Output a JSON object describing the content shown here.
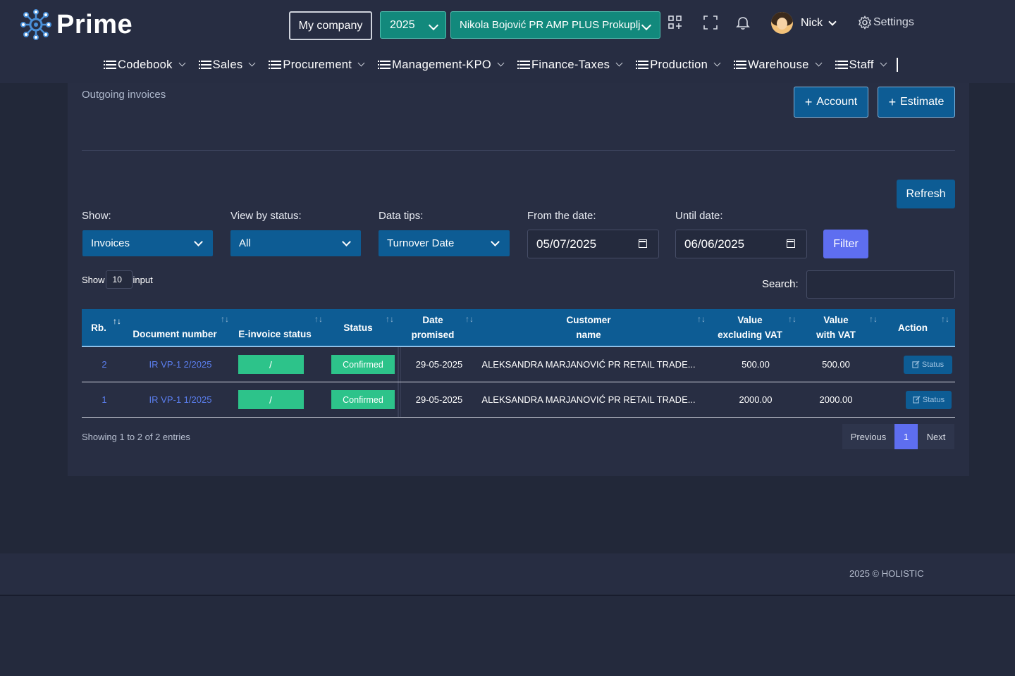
{
  "brand": {
    "name": "Prime"
  },
  "header": {
    "company_button": "My company",
    "year": "2025",
    "firm": "Nikola Bojović PR AMP PLUS Prokuplj",
    "user_name": "Nick",
    "settings_label": "Settings"
  },
  "menu": [
    {
      "label": "Codebook"
    },
    {
      "label": "Sales"
    },
    {
      "label": "Procurement"
    },
    {
      "label": "Management-KPO"
    },
    {
      "label": "Finance-Taxes"
    },
    {
      "label": "Production"
    },
    {
      "label": "Warehouse"
    },
    {
      "label": "Staff"
    }
  ],
  "page": {
    "title": "Outgoing invoices",
    "account_button": "Account",
    "estimate_button": "Estimate",
    "refresh_button": "Refresh",
    "filter_button": "Filter"
  },
  "filters": {
    "show_label": "Show:",
    "show_value": "Invoices",
    "status_label": "View by status:",
    "status_value": "All",
    "tips_label": "Data tips:",
    "tips_value": "Turnover Date",
    "from_label": "From the date:",
    "from_value": "05/07/2025",
    "until_label": "Until date:",
    "until_value": "06/06/2025"
  },
  "table_controls": {
    "show_prefix": "Show",
    "page_size": "10",
    "show_suffix": "input",
    "search_label": "Search:"
  },
  "table": {
    "headers": {
      "rb": "Rb.",
      "doc": "Document number",
      "einv": "E-invoice status",
      "status": "Status",
      "date_1": "Date",
      "date_2": "promised",
      "cust_1": "Customer",
      "cust_2": "name",
      "vex_1": "Value",
      "vex_2": "excluding VAT",
      "vin_1": "Value",
      "vin_2": "with VAT",
      "action": "Action"
    },
    "rows": [
      {
        "rb": "2",
        "doc": "IR VP-1 2/2025",
        "einv": "/",
        "status": "Confirmed",
        "date": "29-05-2025",
        "customer": "ALEKSANDRA MARJANOVIĆ PR RETAIL TRADE...",
        "value_ex": "500.00",
        "value_in": "500.00",
        "action": "Status"
      },
      {
        "rb": "1",
        "doc": "IR VP-1 1/2025",
        "einv": "/",
        "status": "Confirmed",
        "date": "29-05-2025",
        "customer": "ALEKSANDRA MARJANOVIĆ PR RETAIL TRADE...",
        "value_ex": "2000.00",
        "value_in": "2000.00",
        "action": "Status"
      }
    ],
    "info": "Showing 1 to 2 of 2 entries",
    "pager": {
      "prev": "Previous",
      "current": "1",
      "next": "Next"
    }
  },
  "footer": {
    "copyright": "2025 © HOLISTIC"
  },
  "colors": {
    "accent_blue": "#0d5c94",
    "teal": "#12897c",
    "green": "#2dc38a",
    "violet": "#5e6ef0",
    "background": "#222839"
  }
}
